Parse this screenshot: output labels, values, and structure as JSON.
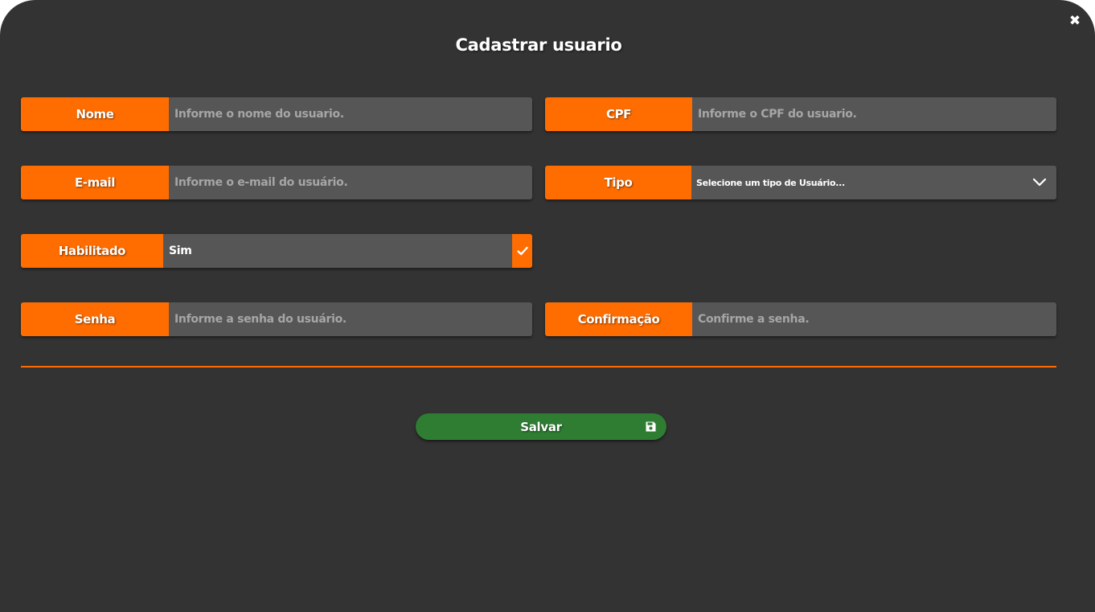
{
  "modal": {
    "title": "Cadastrar usuario",
    "close_icon": "close-icon"
  },
  "form": {
    "nome": {
      "label": "Nome",
      "placeholder": "Informe o nome do usuario.",
      "value": ""
    },
    "cpf": {
      "label": "CPF",
      "placeholder": "Informe o CPF do usuario.",
      "value": ""
    },
    "email": {
      "label": "E-mail",
      "placeholder": "Informe o e-mail do usuário.",
      "value": ""
    },
    "tipo": {
      "label": "Tipo",
      "selected": "Selecione um tipo de Usuário...",
      "icon": "chevron-down-icon"
    },
    "habilitado": {
      "label": "Habilitado",
      "value": "Sim",
      "checked": true,
      "icon": "check-icon"
    },
    "senha": {
      "label": "Senha",
      "placeholder": "Informe a senha do usuário.",
      "value": ""
    },
    "confirmacao": {
      "label": "Confirmação",
      "placeholder": "Confirme a senha.",
      "value": ""
    }
  },
  "actions": {
    "save_label": "Salvar",
    "save_icon": "floppy-disk-icon"
  },
  "colors": {
    "background": "#333333",
    "label_accent": "#ff6d00",
    "field_bg": "#565656",
    "save_button": "#2e7d32",
    "text": "#ffffff",
    "placeholder": "#a6a6a6"
  }
}
